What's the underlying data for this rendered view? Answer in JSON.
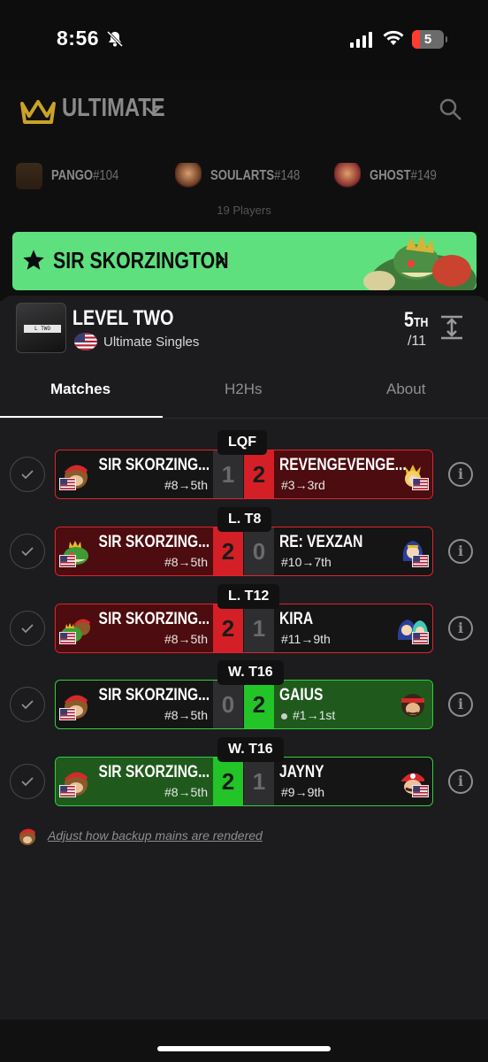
{
  "status_bar": {
    "time": "8:56",
    "battery": "5"
  },
  "header": {
    "game_title": "ULTIMATE"
  },
  "top_players": [
    {
      "name": "PANGO",
      "tag": "#104"
    },
    {
      "name": "SOULARTS",
      "tag": "#148"
    },
    {
      "name": "GHOST",
      "tag": "#149"
    }
  ],
  "players_count": "19 Players",
  "banner": {
    "player_name": "SIR SKORZINGTON",
    "arrow": ">"
  },
  "event": {
    "title": "LEVEL TWO",
    "subtitle": "Ultimate Singles",
    "logo_text": "L TWO",
    "placement": "5",
    "placement_suffix": "TH",
    "total": "/11"
  },
  "tabs": [
    {
      "label": "Matches"
    },
    {
      "label": "H2Hs"
    },
    {
      "label": "About"
    }
  ],
  "matches": [
    {
      "round": "LQF",
      "p1": "SIR SKORZING...",
      "p1_seed": "#8→5th",
      "p1_score": "1",
      "p2": "REVENGEVENGE...",
      "p2_seed": "#3→3rd",
      "p2_score": "2"
    },
    {
      "round": "L. T8",
      "p1": "SIR SKORZING...",
      "p1_seed": "#8→5th",
      "p1_score": "2",
      "p2": "RE: VEXZAN",
      "p2_seed": "#10→7th",
      "p2_score": "0"
    },
    {
      "round": "L. T12",
      "p1": "SIR SKORZING...",
      "p1_seed": "#8→5th",
      "p1_score": "2",
      "p2": "KIRA",
      "p2_seed": "#11→9th",
      "p2_score": "1"
    },
    {
      "round": "W. T16",
      "p1": "SIR SKORZING...",
      "p1_seed": "#8→5th",
      "p1_score": "0",
      "p2": "GAIUS",
      "p2_seed": "#1→1st",
      "p2_score": "2"
    },
    {
      "round": "W. T16",
      "p1": "SIR SKORZING...",
      "p1_seed": "#8→5th",
      "p1_score": "2",
      "p2": "JAYNY",
      "p2_seed": "#9→9th",
      "p2_score": "1"
    }
  ],
  "footnote": "Adjust how backup mains are rendered",
  "icons": {
    "crown": "crown-icon",
    "search": "search-icon",
    "star": "star-icon",
    "expand": "expand-icon",
    "check": "check-icon",
    "info": "info-icon",
    "flag": "us-flag-icon"
  },
  "colors": {
    "banner_green": "#5ee07e",
    "loss_red": "#d41f26",
    "win_green": "#22c427",
    "crown_gold": "#c9a227"
  }
}
